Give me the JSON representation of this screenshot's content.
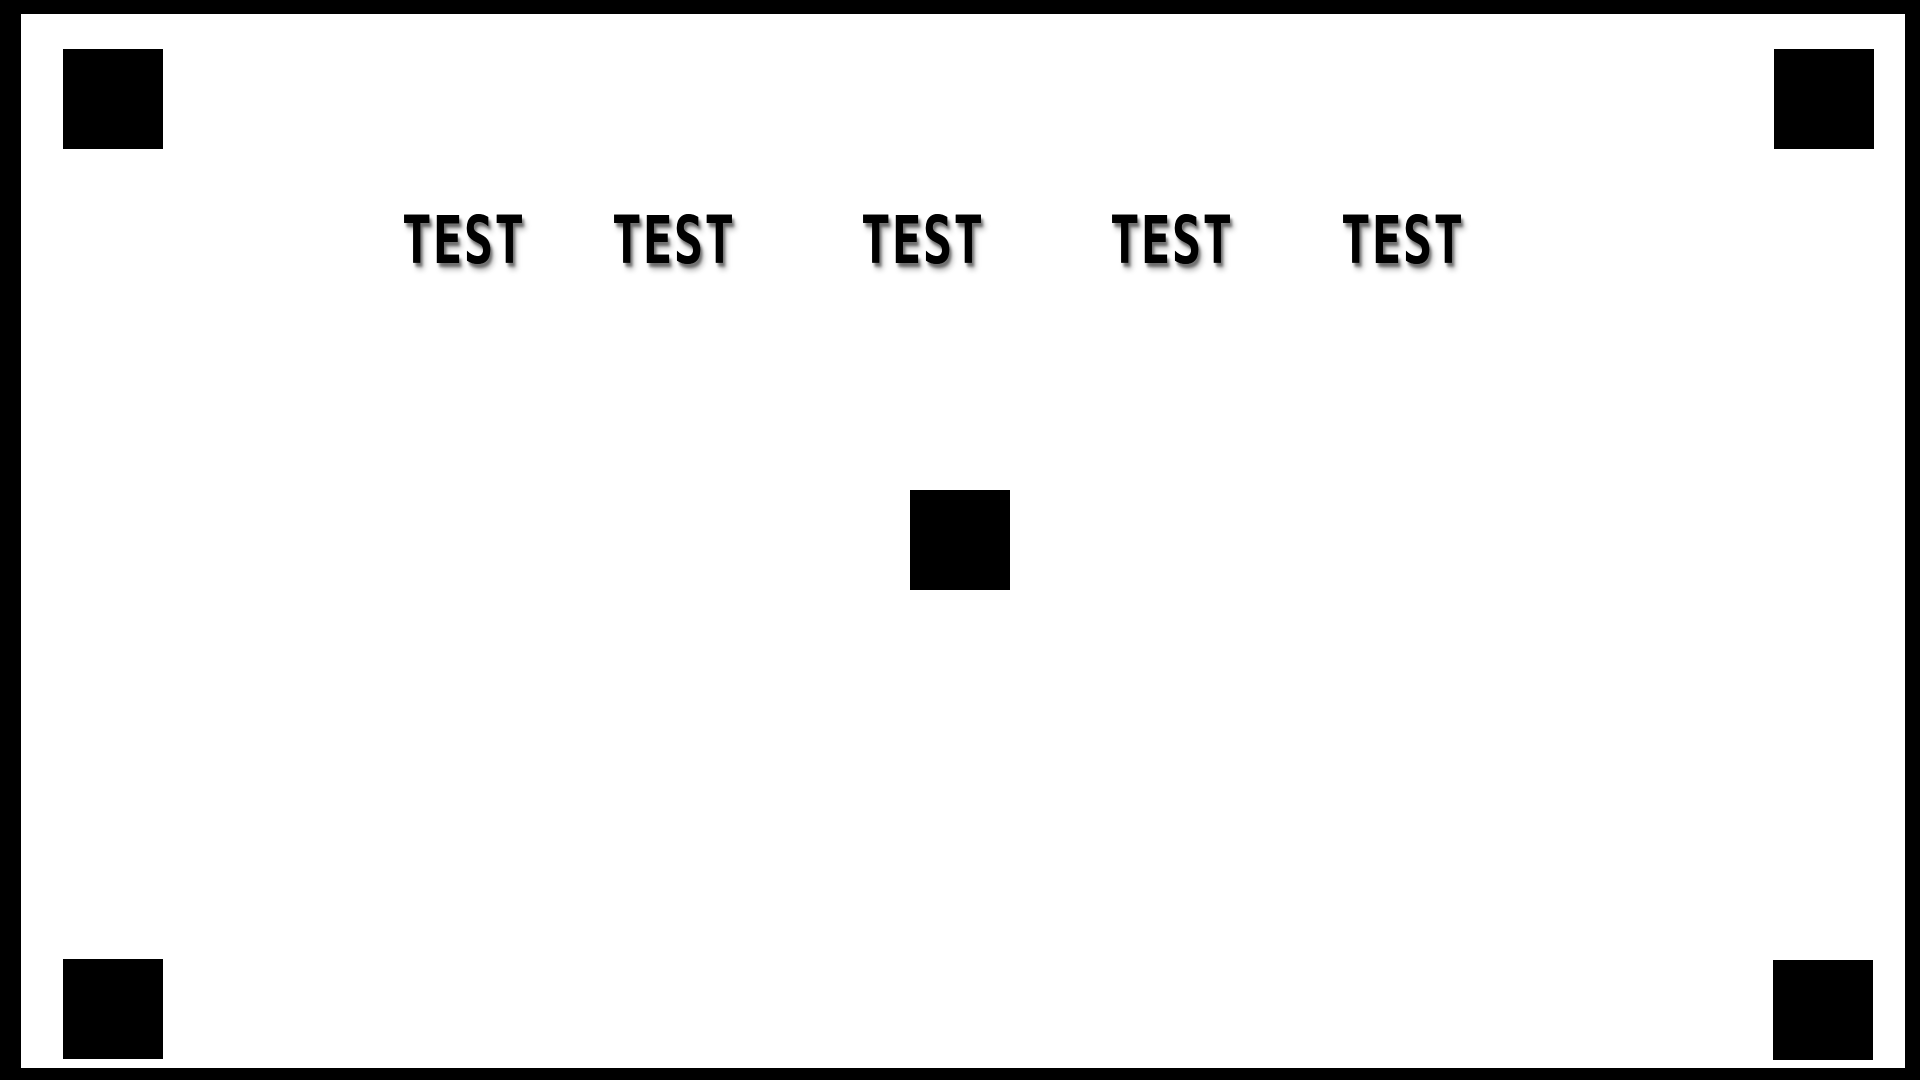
{
  "screen": {
    "background_color": "#ffffff",
    "border_color": "#000000",
    "marker_color": "#000000",
    "text_color": "#000000"
  },
  "words": [
    {
      "label": "TEST"
    },
    {
      "label": "TEST"
    },
    {
      "label": "TEST"
    },
    {
      "label": "TEST"
    },
    {
      "label": "TEST"
    }
  ],
  "markers": [
    {
      "name": "top-left"
    },
    {
      "name": "top-right"
    },
    {
      "name": "bottom-left"
    },
    {
      "name": "bottom-right"
    },
    {
      "name": "center"
    }
  ]
}
